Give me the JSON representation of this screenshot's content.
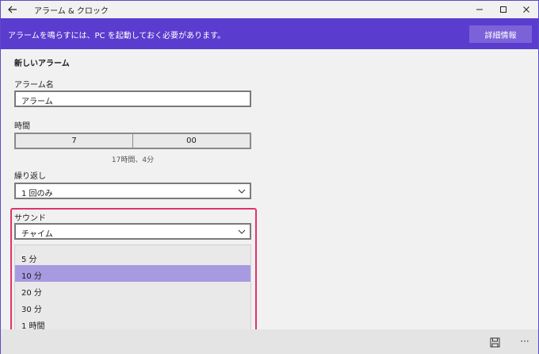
{
  "window": {
    "app_title": "アラーム & クロック",
    "minimize_icon": "minimize-icon",
    "maximize_icon": "maximize-icon",
    "close_icon": "close-icon"
  },
  "banner": {
    "message": "アラームを鳴らすには、PC を起動しておく必要があります。",
    "detail_button": "詳細情報",
    "background": "#5a3cce"
  },
  "form": {
    "section_title": "新しいアラーム",
    "name": {
      "label": "アラーム名",
      "value": "アラーム"
    },
    "time": {
      "label": "時間",
      "hour": "7",
      "minute": "00",
      "remaining": "17時間、4分"
    },
    "repeat": {
      "label": "繰り返し",
      "value": "1 回のみ"
    },
    "sound": {
      "label": "サウンド",
      "value": "チャイム"
    }
  },
  "snooze_options": {
    "items": [
      "5 分",
      "10 分",
      "20 分",
      "30 分",
      "1 時間"
    ],
    "selected": "10 分",
    "selected_color": "#a89ae0"
  },
  "highlight_color": "#e0336e",
  "bottom_bar": {
    "save_icon": "save-icon",
    "more_label": "···"
  }
}
